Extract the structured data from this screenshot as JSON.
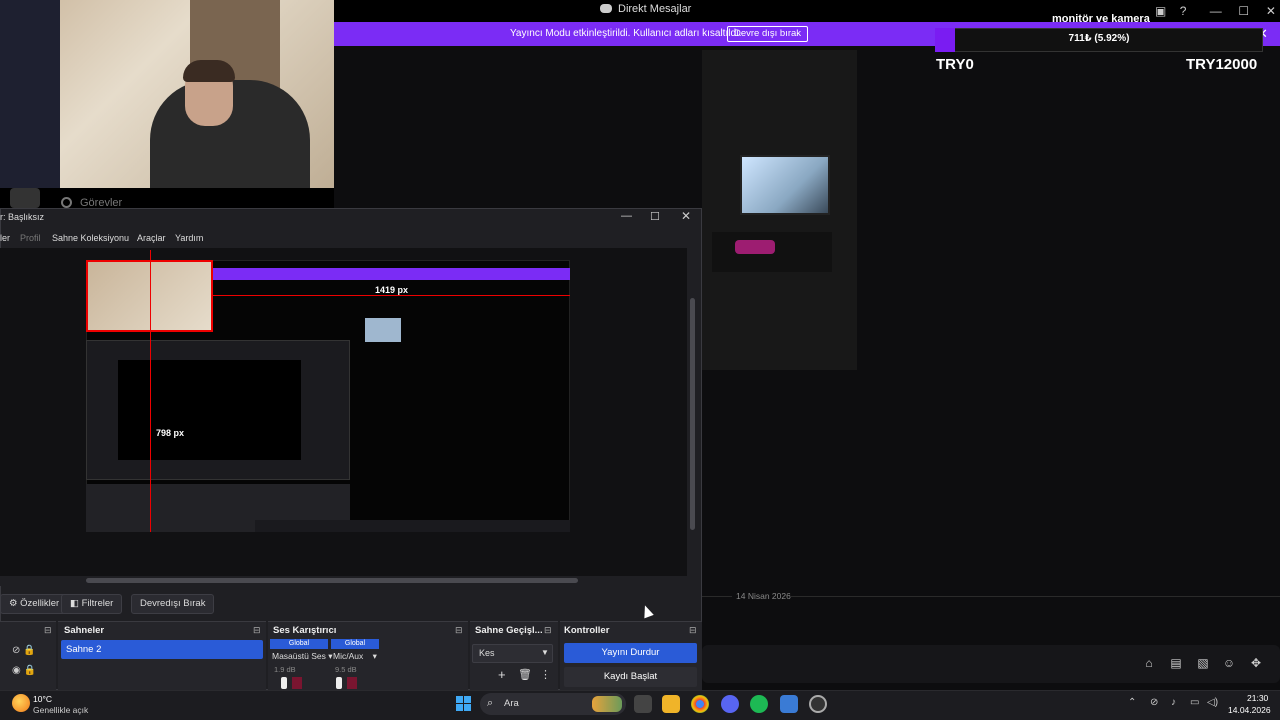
{
  "discord": {
    "window_title": "Direkt Mesajlar",
    "streamer_mode_text": "Yayıncı Modu etkinleştirildi. Kullanıcı adları kısaltıldı.",
    "streamer_mode_button": "Devre dışı bırak",
    "date_separator": "14 Nisan 2026",
    "sidebar_label": "Görevler"
  },
  "overlay": {
    "title": "monitör ve kamera",
    "progress_label": "711₺ (5.92%)",
    "progress_fraction": 0.0592,
    "min_label": "TRY0",
    "max_label": "TRY12000",
    "fill_color": "#7a1cf2"
  },
  "obs": {
    "window_title": "r: Başlıksız",
    "menu": [
      "ler",
      "Profil",
      "Sahne Koleksiyonu",
      "Araçlar",
      "Yardım"
    ],
    "preview_measure_h": "1419 px",
    "preview_measure_v": "798 px",
    "toolbar": {
      "properties": "Özellikler",
      "filters": "Filtreler",
      "deactivate": "Devredışı Bırak"
    },
    "scenes": {
      "title": "Sahneler",
      "items": [
        "Sahne 2"
      ]
    },
    "mixer": {
      "title": "Ses Karıştırıcı",
      "global_label": "Global",
      "channels": [
        {
          "name": "Masaüstü Ses",
          "db": "1.9 dB"
        },
        {
          "name": "Mic/Aux",
          "db": "9.5 dB"
        }
      ]
    },
    "transitions": {
      "title": "Sahne Geçişl...",
      "selected": "Kes"
    },
    "controls": {
      "title": "Kontroller",
      "stop_stream": "Yayını Durdur",
      "start_record": "Kaydı Başlat"
    }
  },
  "taskbar": {
    "weather_temp": "10°C",
    "weather_desc": "Genellikle açık",
    "search_label": "Ara",
    "time": "21:30",
    "date": "14.04.2026"
  },
  "colors": {
    "accent_purple": "#7b2cf5",
    "obs_blue": "#2a5bd7"
  }
}
